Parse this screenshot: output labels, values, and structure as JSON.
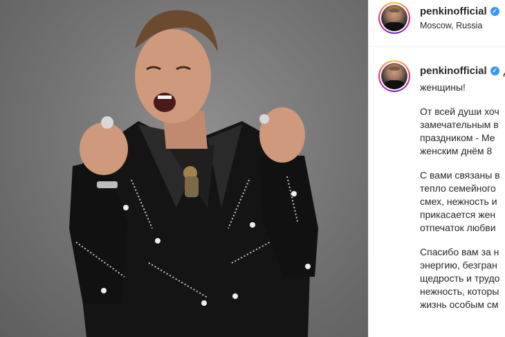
{
  "post": {
    "username": "penkinofficial",
    "location": "Moscow, Russia",
    "verified_glyph": "✓",
    "caption_first_word": "Д",
    "caption_paragraphs": [
      [
        "женщины!"
      ],
      [
        "От всей души хоч",
        "замечательным в",
        "праздником - Ме",
        "женским днём 8"
      ],
      [
        "С вами связаны в",
        "тепло семейного",
        "смех, нежность и",
        "прикасается жен",
        "отпечаток любви"
      ],
      [
        "Спасибо вам за н",
        "энергию, безгран",
        "щедрость и трудо",
        "нежность, которы",
        "жизнь особым см"
      ]
    ]
  },
  "icons": {
    "verified": "verified-badge-icon"
  },
  "colors": {
    "verified": "#3897f0",
    "text": "#262626",
    "photo_background": "#727272"
  }
}
